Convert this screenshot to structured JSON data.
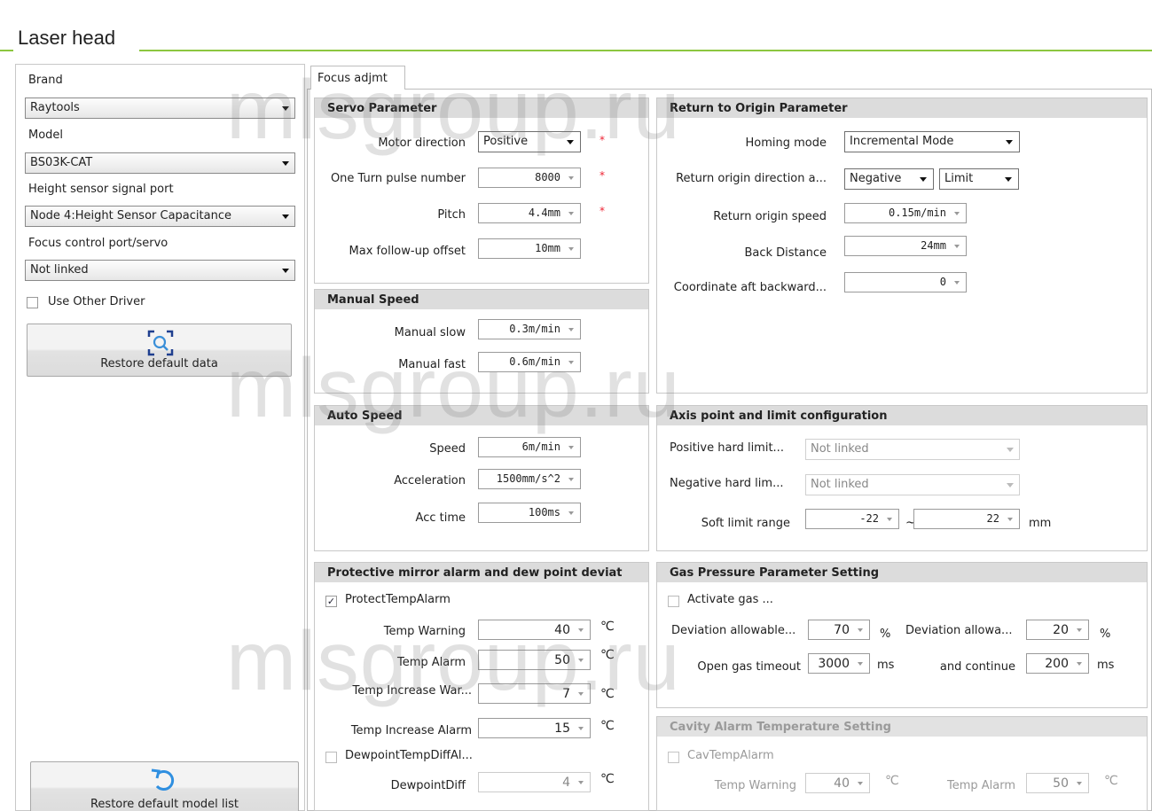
{
  "window_title": "Laser head",
  "left": {
    "brand_label": "Brand",
    "brand_value": "Raytools",
    "model_label": "Model",
    "model_value": "BS03K-CAT",
    "height_port_label": "Height sensor signal port",
    "height_port_value": "Node 4:Height Sensor Capacitance",
    "focus_port_label": "Focus control port/servo",
    "focus_port_value": "Not linked",
    "use_other_driver": "Use Other Driver",
    "restore_default_data": "Restore default data",
    "restore_default_model_list": "Restore default model list"
  },
  "tab": {
    "label": "Focus adjmt"
  },
  "servo": {
    "title": "Servo Parameter",
    "motor_direction_label": "Motor direction",
    "motor_direction_value": "Positive",
    "one_turn_label": "One Turn pulse number",
    "one_turn_value": "8000",
    "pitch_label": "Pitch",
    "pitch_value": "4.4mm",
    "max_follow_label": "Max follow-up offset",
    "max_follow_value": "10mm",
    "required_mark": "*"
  },
  "manual": {
    "title": "Manual Speed",
    "slow_label": "Manual slow",
    "slow_value": "0.3m/min",
    "fast_label": "Manual fast",
    "fast_value": "0.6m/min"
  },
  "auto": {
    "title": "Auto Speed",
    "speed_label": "Speed",
    "speed_value": "6m/min",
    "accel_label": "Acceleration",
    "accel_value": "1500mm/s^2",
    "acctime_label": "Acc time",
    "acctime_value": "100ms"
  },
  "origin": {
    "title": "Return to Origin Parameter",
    "homing_label": "Homing mode",
    "homing_value": "Incremental Mode",
    "direction_label": "Return origin direction a...",
    "direction_value": "Negative",
    "direction_mode": "Limit",
    "speed_label": "Return origin speed",
    "speed_value": "0.15m/min",
    "back_label": "Back Distance",
    "back_value": "24mm",
    "coord_label": "Coordinate aft backward...",
    "coord_value": "0"
  },
  "axis": {
    "title": "Axis point and limit configuration",
    "pos_label": "Positive hard limit...",
    "pos_value": "Not linked",
    "neg_label": "Negative hard lim...",
    "neg_value": "Not linked",
    "soft_label": "Soft limit range",
    "soft_min": "-22",
    "tilde": "~",
    "soft_max": "22",
    "unit": "mm"
  },
  "mirror": {
    "title": "Protective mirror alarm and dew point deviat",
    "protect_label": "ProtectTempAlarm",
    "warn_label": "Temp Warning",
    "warn_value": "40",
    "alarm_label": "Temp Alarm",
    "alarm_value": "50",
    "incwarn_label": "Temp Increase War...",
    "incwarn_value": "7",
    "incalarm_label": "Temp Increase Alarm",
    "incalarm_value": "15",
    "dew_check_label": "DewpointTempDiffAl...",
    "dew_label": "DewpointDiff",
    "dew_value": "4",
    "unit_c": "℃"
  },
  "gas": {
    "title": "Gas Pressure Parameter Setting",
    "activate_label": "Activate gas ...",
    "dev1_label": "Deviation allowable...",
    "dev1_value": "70",
    "dev2_label": "Deviation allowa...",
    "dev2_value": "20",
    "pct": "%",
    "timeout_label": "Open gas timeout",
    "timeout_value": "3000",
    "continue_label": "and continue",
    "continue_value": "200",
    "ms": "ms"
  },
  "cavity": {
    "title": "Cavity Alarm Temperature Setting",
    "check_label": "CavTempAlarm",
    "warn_label": "Temp Warning",
    "warn_value": "40",
    "alarm_label": "Temp Alarm",
    "alarm_value": "50",
    "unit_c": "℃"
  },
  "watermark": "mlsgroup.ru"
}
